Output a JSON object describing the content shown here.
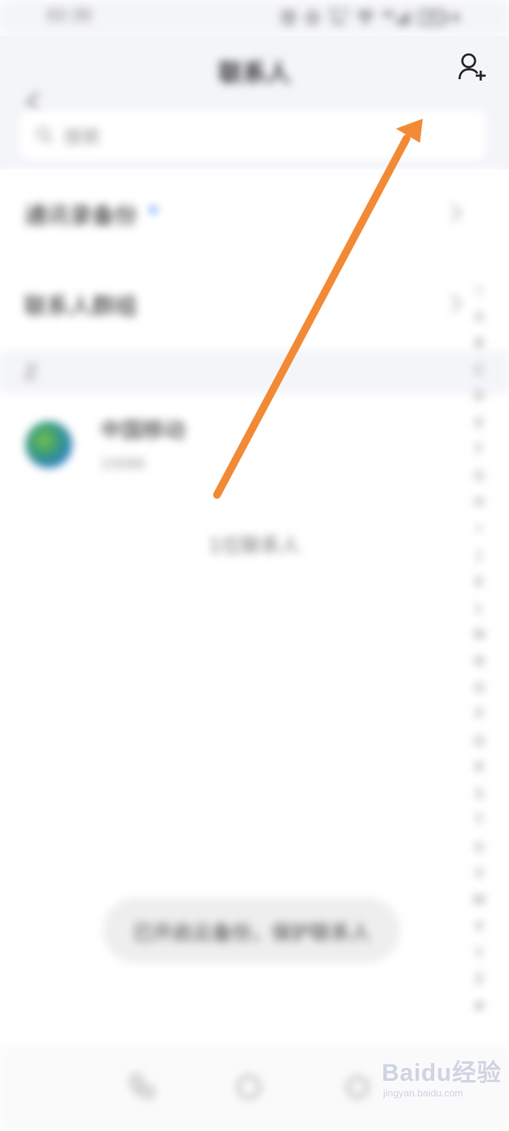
{
  "status_bar": {
    "time": "02:30",
    "net_speed_value": "27.3",
    "net_speed_unit": "K/s",
    "network": "5G",
    "battery": "43"
  },
  "header": {
    "title": "联系人",
    "search_placeholder": "搜索"
  },
  "rows": [
    {
      "label": "通讯录备份"
    },
    {
      "label": "联系人群组"
    }
  ],
  "section": {
    "letter": "Z"
  },
  "contact": {
    "name": "中国移动",
    "subtitle": "10086"
  },
  "contact_count": "1位联系人",
  "cloud_pill": "已开启云备份，保护联系人",
  "alpha_index": [
    "☆",
    "A",
    "B",
    "C",
    "D",
    "E",
    "F",
    "G",
    "H",
    "I",
    "J",
    "K",
    "L",
    "M",
    "N",
    "O",
    "P",
    "Q",
    "R",
    "S",
    "T",
    "U",
    "V",
    "W",
    "X",
    "Y",
    "Z",
    "#"
  ],
  "watermark": {
    "logo": "Baidu经验",
    "url": "jingyan.baidu.com"
  },
  "annotation": {
    "color": "#f28a35"
  }
}
